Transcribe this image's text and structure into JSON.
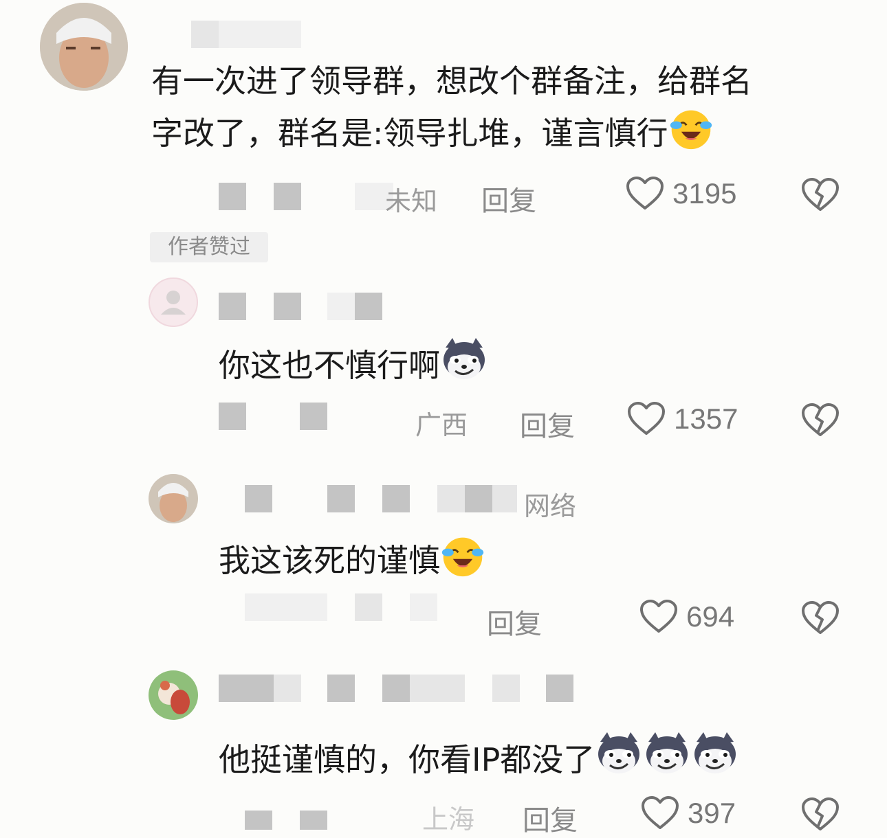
{
  "comments": [
    {
      "text_line1": "有一次进了领导群，想改个群备注，给群名",
      "text_line2": "字改了，群名是:领导扎堆，谨言慎行",
      "emoji": "laugh-cry-emoji",
      "location": "未知",
      "reply_label": "回复",
      "like_count": "3195",
      "badge": "作者赞过"
    },
    {
      "text": "你这也不慎行啊",
      "emoji": "husky-emoji",
      "location": "广西",
      "reply_label": "回复",
      "like_count": "1357"
    },
    {
      "name_suffix": "网络",
      "text": "我这该死的谨慎",
      "emoji": "laugh-cry-emoji",
      "reply_label": "回复",
      "like_count": "694"
    },
    {
      "text": "他挺谨慎的，你看IP都没了",
      "emoji": "husky-emoji",
      "location": "上海",
      "reply_label": "回复",
      "like_count": "397"
    }
  ],
  "icons": {
    "like": "heart-outline-icon",
    "dislike": "broken-heart-icon"
  },
  "colors": {
    "background": "#fcfcfa",
    "meta_gray": "#9a9a9a",
    "text": "#1b1b1b"
  }
}
